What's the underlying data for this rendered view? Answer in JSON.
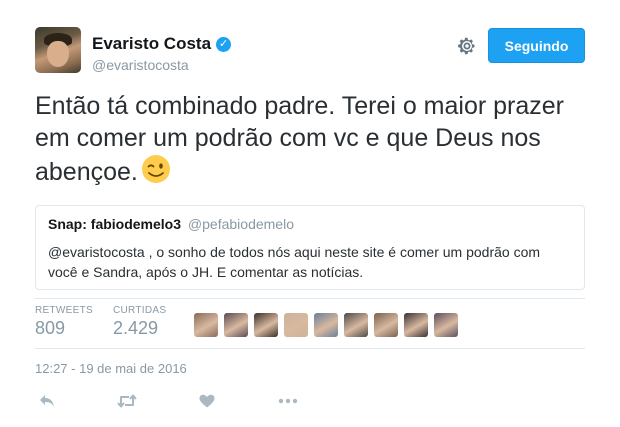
{
  "user": {
    "name": "Evaristo Costa",
    "handle": "@evaristocosta",
    "verified_icon": "verified-badge-icon"
  },
  "header": {
    "settings_icon": "gear-icon",
    "follow_label": "Seguindo"
  },
  "tweet": {
    "text": "Então tá combinado padre. Terei o maior prazer em comer um podrão com vc e que Deus nos abençoe.",
    "emoji": "winking-face-emoji"
  },
  "quote": {
    "name": "Snap: fabiodemelo3",
    "handle": "@pefabiodemelo",
    "text": "@evaristocosta , o sonho de todos nós aqui neste site é comer um podrão com você e Sandra, após o JH. E comentar as notícias."
  },
  "stats": {
    "retweets_label": "RETWEETS",
    "retweets_value": "809",
    "likes_label": "CURTIDAS",
    "likes_value": "2.429",
    "liker_avatar_colors": [
      "#8a6b5a",
      "#5c4a52",
      "#3b3028",
      "#c9b49a",
      "#6b7f9a",
      "#4d4a48",
      "#7a6050",
      "#3a3035",
      "#5b4e60"
    ]
  },
  "timestamp": "12:27 - 19 de mai de 2016",
  "actions": {
    "reply_icon": "reply-icon",
    "retweet_icon": "retweet-icon",
    "like_icon": "heart-icon",
    "more_icon": "more-icon"
  },
  "colors": {
    "accent": "#1da1f2",
    "muted": "#8899a6",
    "border": "#e1e8ed"
  }
}
